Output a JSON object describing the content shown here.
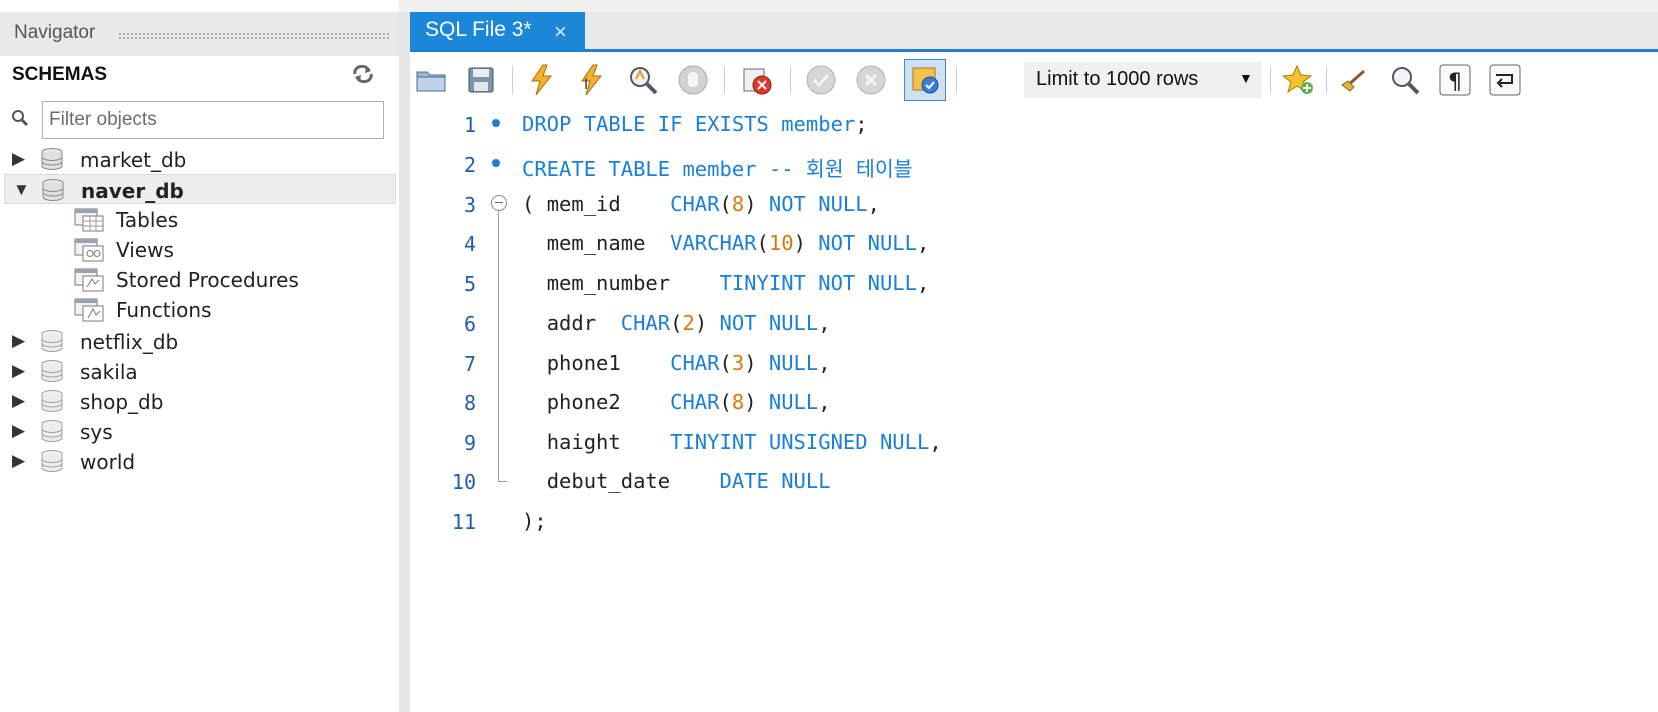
{
  "navigator": {
    "title": "Navigator",
    "section_label": "SCHEMAS",
    "filter_placeholder": "Filter objects",
    "schemas": [
      {
        "name": "market_db",
        "expanded": false,
        "selected": false
      },
      {
        "name": "naver_db",
        "expanded": true,
        "selected": true
      },
      {
        "name": "netflix_db",
        "expanded": false,
        "selected": false
      },
      {
        "name": "sakila",
        "expanded": false,
        "selected": false
      },
      {
        "name": "shop_db",
        "expanded": false,
        "selected": false
      },
      {
        "name": "sys",
        "expanded": false,
        "selected": false
      },
      {
        "name": "world",
        "expanded": false,
        "selected": false
      }
    ],
    "naver_db_children": [
      "Tables",
      "Views",
      "Stored Procedures",
      "Functions"
    ]
  },
  "editor": {
    "tab_label": "SQL File 3*",
    "tab_close": "×",
    "limit_label": "Limit to 1000 rows",
    "line_numbers": [
      "1",
      "2",
      "3",
      "4",
      "5",
      "6",
      "7",
      "8",
      "9",
      "10",
      "11"
    ],
    "sql_lines": [
      "DROP TABLE IF EXISTS member;",
      "CREATE TABLE member -- 회원 테이블",
      "( mem_id    CHAR(8) NOT NULL,",
      "  mem_name  VARCHAR(10) NOT NULL,",
      "  mem_number    TINYINT NOT NULL,",
      "  addr  CHAR(2) NOT NULL,",
      "  phone1    CHAR(3) NULL,",
      "  phone2    CHAR(8) NULL,",
      "  haight    TINYINT UNSIGNED NULL,",
      "  debut_date    DATE NULL",
      ");"
    ],
    "toolbar_icons": [
      "open-folder-icon",
      "save-icon",
      "execute-icon",
      "execute-current-icon",
      "explain-icon",
      "stop-icon",
      "toggle-error-stop-icon",
      "commit-icon",
      "rollback-icon",
      "autocommit-icon",
      "add-snippet-icon",
      "beautify-icon",
      "find-icon",
      "invisible-chars-icon",
      "wrap-lines-icon"
    ]
  },
  "colors": {
    "accent": "#1c86d9",
    "keyword": "#1a7fd9",
    "number": "#d77a0b",
    "line_number": "#1e5fa8"
  }
}
